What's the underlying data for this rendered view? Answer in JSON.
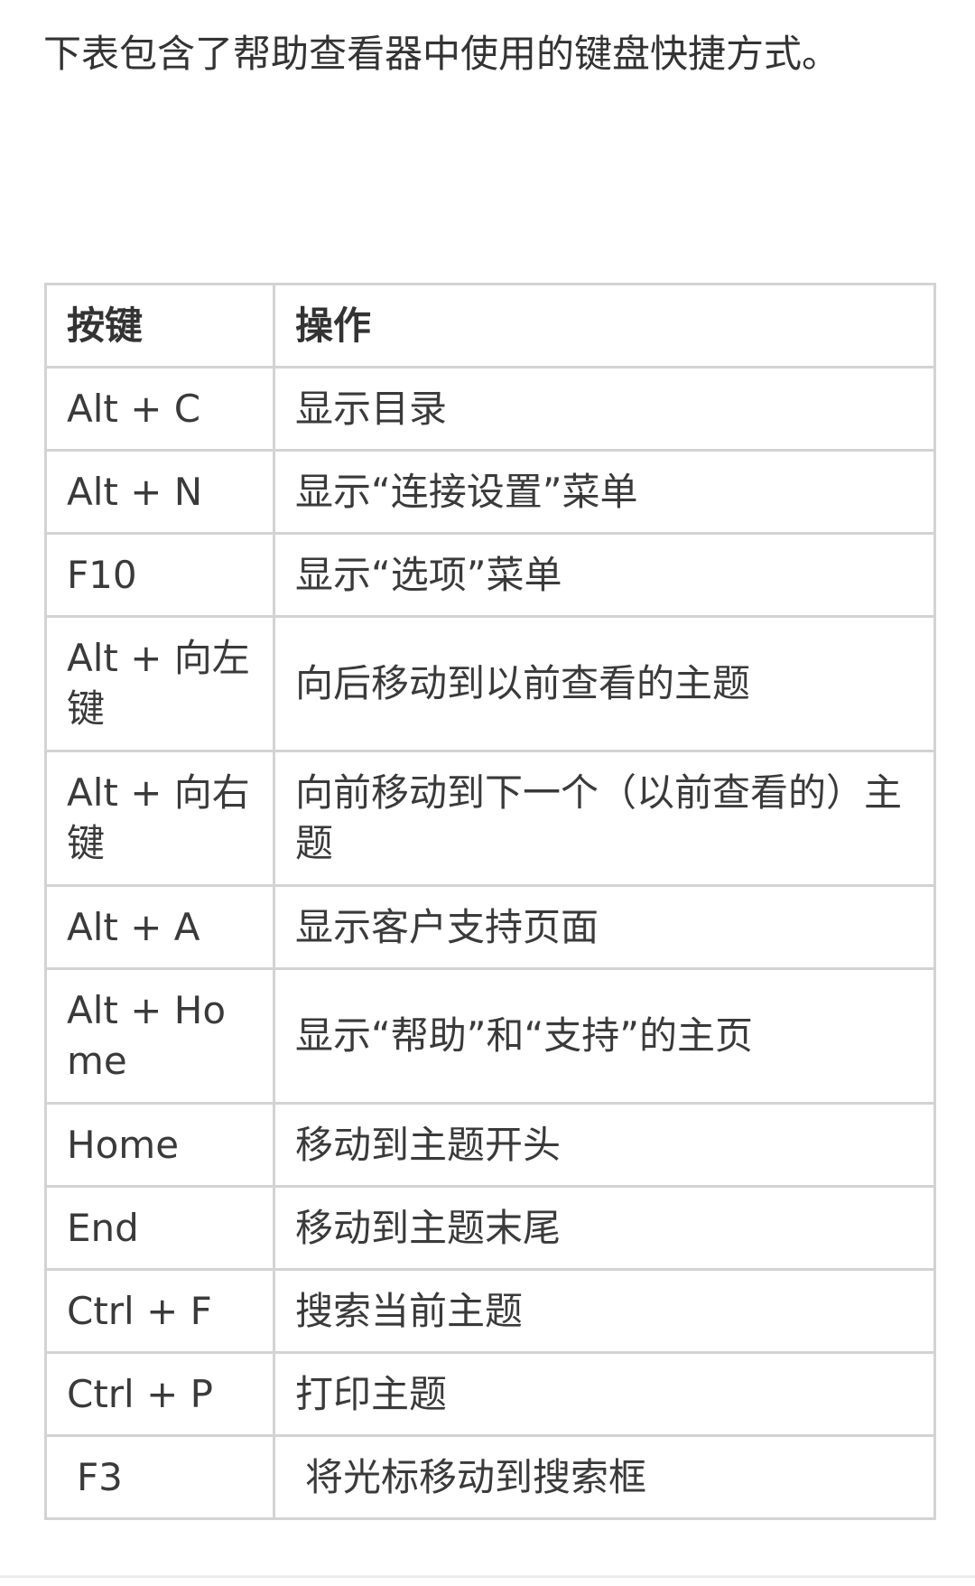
{
  "intro_text": "下表包含了帮助查看器中使用的键盘快捷方式。",
  "table": {
    "headers": {
      "key": "按键",
      "action": "操作"
    },
    "rows": [
      {
        "key": "Alt + C",
        "action": "显示目录"
      },
      {
        "key": "Alt + N",
        "action": "显示“连接设置”菜单"
      },
      {
        "key": "F10",
        "action": "显示“选项”菜单"
      },
      {
        "key": "Alt + 向左键",
        "action": "向后移动到以前查看的主题"
      },
      {
        "key": "Alt + 向右键",
        "action": "向前移动到下一个（以前查看的）主题"
      },
      {
        "key": "Alt + A",
        "action": "显示客户支持页面"
      },
      {
        "key": "Alt + Home",
        "action": "显示“帮助”和“支持”的主页"
      },
      {
        "key": "Home",
        "action": "移动到主题开头"
      },
      {
        "key": "End",
        "action": "移动到主题末尾"
      },
      {
        "key": "Ctrl + F",
        "action": "搜索当前主题"
      },
      {
        "key": "Ctrl + P",
        "action": "打印主题"
      },
      {
        "key": "F3",
        "action": "将光标移动到搜索框"
      }
    ]
  }
}
